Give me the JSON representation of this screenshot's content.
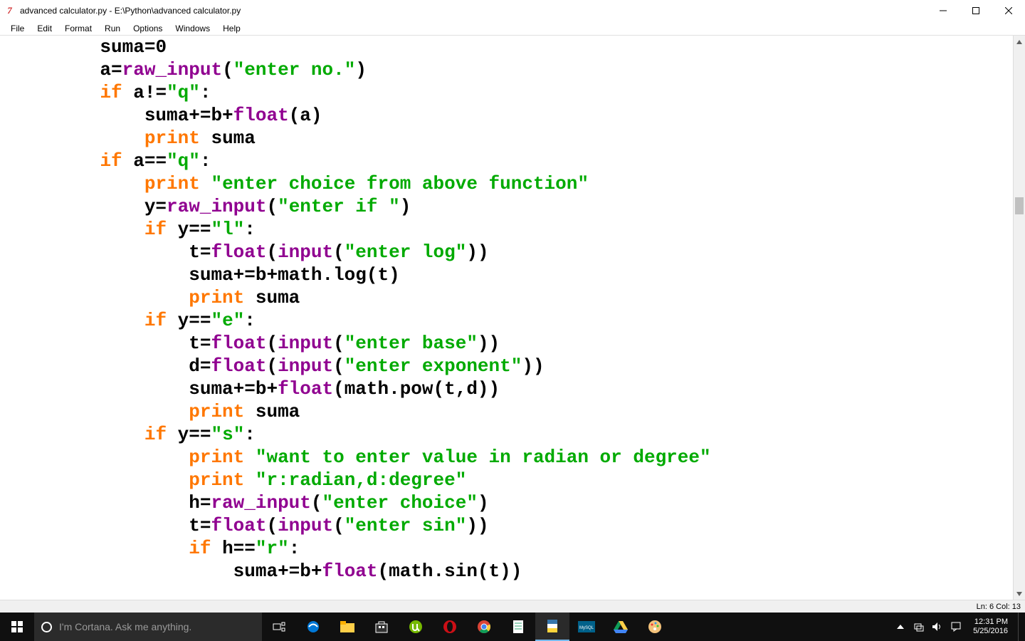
{
  "titlebar": {
    "title": "advanced calculator.py - E:\\Python\\advanced calculator.py"
  },
  "menubar": {
    "items": [
      "File",
      "Edit",
      "Format",
      "Run",
      "Options",
      "Windows",
      "Help"
    ]
  },
  "statusbar": {
    "text": "Ln: 6 Col: 13"
  },
  "taskbar": {
    "search_placeholder": "I'm Cortana. Ask me anything.",
    "clock_time": "12:31 PM",
    "clock_date": "5/25/2016"
  },
  "code": {
    "lines": [
      [
        [
          "plain",
          "         suma="
        ],
        [
          "num",
          "0"
        ]
      ],
      [
        [
          "plain",
          "         a="
        ],
        [
          "fn",
          "raw_input"
        ],
        [
          "plain",
          "("
        ],
        [
          "str",
          "\"enter no.\""
        ],
        [
          "plain",
          ")"
        ]
      ],
      [
        [
          "plain",
          "         "
        ],
        [
          "kw",
          "if"
        ],
        [
          "plain",
          " a!="
        ],
        [
          "str",
          "\"q\""
        ],
        [
          "plain",
          ":"
        ]
      ],
      [
        [
          "plain",
          "             suma+=b+"
        ],
        [
          "fn",
          "float"
        ],
        [
          "plain",
          "(a)"
        ]
      ],
      [
        [
          "plain",
          "             "
        ],
        [
          "kw",
          "print"
        ],
        [
          "plain",
          " suma"
        ]
      ],
      [
        [
          "plain",
          "         "
        ],
        [
          "kw",
          "if"
        ],
        [
          "plain",
          " a=="
        ],
        [
          "str",
          "\"q\""
        ],
        [
          "plain",
          ":"
        ]
      ],
      [
        [
          "plain",
          "             "
        ],
        [
          "kw",
          "print"
        ],
        [
          "plain",
          " "
        ],
        [
          "str",
          "\"enter choice from above function\""
        ]
      ],
      [
        [
          "plain",
          "             y="
        ],
        [
          "fn",
          "raw_input"
        ],
        [
          "plain",
          "("
        ],
        [
          "str",
          "\"enter if \""
        ],
        [
          "plain",
          ")"
        ]
      ],
      [
        [
          "plain",
          "             "
        ],
        [
          "kw",
          "if"
        ],
        [
          "plain",
          " y=="
        ],
        [
          "str",
          "\"l\""
        ],
        [
          "plain",
          ":"
        ]
      ],
      [
        [
          "plain",
          "                 t="
        ],
        [
          "fn",
          "float"
        ],
        [
          "plain",
          "("
        ],
        [
          "fn",
          "input"
        ],
        [
          "plain",
          "("
        ],
        [
          "str",
          "\"enter log\""
        ],
        [
          "plain",
          "))"
        ]
      ],
      [
        [
          "plain",
          "                 suma+=b+math.log(t)"
        ]
      ],
      [
        [
          "plain",
          "                 "
        ],
        [
          "kw",
          "print"
        ],
        [
          "plain",
          " suma"
        ]
      ],
      [
        [
          "plain",
          "             "
        ],
        [
          "kw",
          "if"
        ],
        [
          "plain",
          " y=="
        ],
        [
          "str",
          "\"e\""
        ],
        [
          "plain",
          ":"
        ]
      ],
      [
        [
          "plain",
          "                 t="
        ],
        [
          "fn",
          "float"
        ],
        [
          "plain",
          "("
        ],
        [
          "fn",
          "input"
        ],
        [
          "plain",
          "("
        ],
        [
          "str",
          "\"enter base\""
        ],
        [
          "plain",
          "))"
        ]
      ],
      [
        [
          "plain",
          "                 d="
        ],
        [
          "fn",
          "float"
        ],
        [
          "plain",
          "("
        ],
        [
          "fn",
          "input"
        ],
        [
          "plain",
          "("
        ],
        [
          "str",
          "\"enter exponent\""
        ],
        [
          "plain",
          "))"
        ]
      ],
      [
        [
          "plain",
          "                 suma+=b+"
        ],
        [
          "fn",
          "float"
        ],
        [
          "plain",
          "(math.pow(t,d))"
        ]
      ],
      [
        [
          "plain",
          "                 "
        ],
        [
          "kw",
          "print"
        ],
        [
          "plain",
          " suma"
        ]
      ],
      [
        [
          "plain",
          "             "
        ],
        [
          "kw",
          "if"
        ],
        [
          "plain",
          " y=="
        ],
        [
          "str",
          "\"s\""
        ],
        [
          "plain",
          ":"
        ]
      ],
      [
        [
          "plain",
          "                 "
        ],
        [
          "kw",
          "print"
        ],
        [
          "plain",
          " "
        ],
        [
          "str",
          "\"want to enter value in radian or degree\""
        ]
      ],
      [
        [
          "plain",
          "                 "
        ],
        [
          "kw",
          "print"
        ],
        [
          "plain",
          " "
        ],
        [
          "str",
          "\"r:radian,d:degree\""
        ]
      ],
      [
        [
          "plain",
          "                 h="
        ],
        [
          "fn",
          "raw_input"
        ],
        [
          "plain",
          "("
        ],
        [
          "str",
          "\"enter choice\""
        ],
        [
          "plain",
          ")"
        ]
      ],
      [
        [
          "plain",
          "                 t="
        ],
        [
          "fn",
          "float"
        ],
        [
          "plain",
          "("
        ],
        [
          "fn",
          "input"
        ],
        [
          "plain",
          "("
        ],
        [
          "str",
          "\"enter sin\""
        ],
        [
          "plain",
          "))"
        ]
      ],
      [
        [
          "plain",
          "                 "
        ],
        [
          "kw",
          "if"
        ],
        [
          "plain",
          " h=="
        ],
        [
          "str",
          "\"r\""
        ],
        [
          "plain",
          ":"
        ]
      ],
      [
        [
          "plain",
          "                     suma+=b+"
        ],
        [
          "fn",
          "float"
        ],
        [
          "plain",
          "(math.sin(t))"
        ]
      ]
    ]
  }
}
